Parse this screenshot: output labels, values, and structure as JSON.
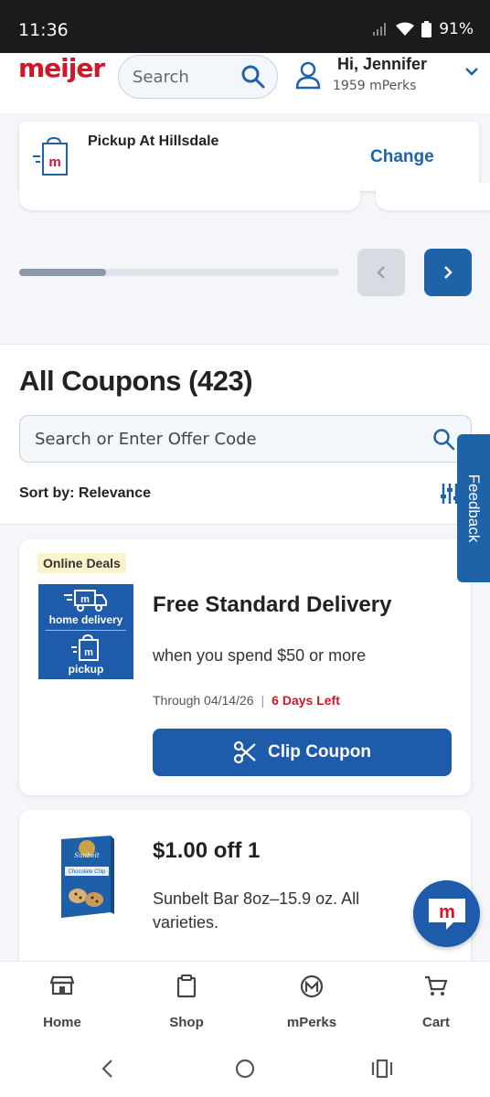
{
  "status_bar": {
    "time": "11:36",
    "battery": "91%"
  },
  "header": {
    "logo": "meijer",
    "search_placeholder": "Search",
    "greeting": "Hi, Jennifer",
    "perks": "1959 mPerks"
  },
  "pickup": {
    "label": "Pickup At Hillsdale",
    "change": "Change"
  },
  "carousel": {
    "progress": 0.27
  },
  "coupons": {
    "title": "All Coupons (423)",
    "search_placeholder": "Search or Enter Offer Code",
    "sort_prefix": "Sort by:",
    "sort_value": "Relevance"
  },
  "feedback": "Feedback",
  "coupon1": {
    "badge": "Online Deals",
    "img_text_top": "home delivery",
    "img_text_bottom": "pickup",
    "title": "Free Standard Delivery",
    "desc": "when you spend $50 or more",
    "through": "Through 04/14/26",
    "days_left": "6 Days Left",
    "clip": "Clip Coupon"
  },
  "coupon2": {
    "title": "$1.00 off 1",
    "desc": "Sunbelt Bar 8oz–15.9 oz. All varieties.",
    "img_brand": "Sunbelt",
    "img_label": "Chocolate Chip"
  },
  "nav": {
    "home": "Home",
    "shop": "Shop",
    "mperks": "mPerks",
    "cart": "Cart"
  },
  "colors": {
    "brand_blue": "#1e5baa",
    "brand_red": "#d3142b"
  }
}
